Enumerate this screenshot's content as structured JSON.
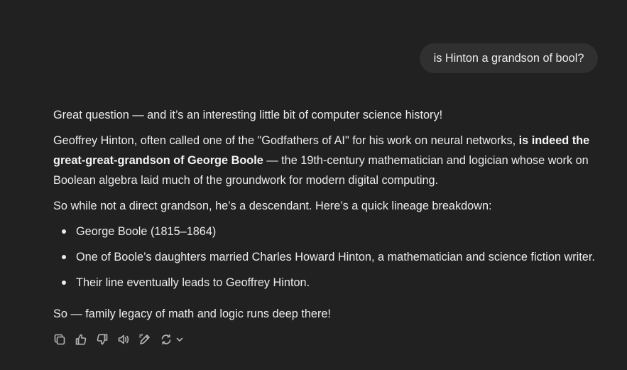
{
  "user_message": "is Hinton a grandson of bool?",
  "assistant": {
    "intro": "Great question — and it’s an interesting little bit of computer science history!",
    "para2_before": "Geoffrey Hinton, often called one of the \"Godfathers of AI\" for his work on neural networks, ",
    "para2_bold": "is indeed the great-great-grandson of George Boole",
    "para2_after": " — the 19th-century mathematician and logician whose work on Boolean algebra laid much of the groundwork for modern digital computing.",
    "para3": "So while not a direct grandson, he’s a descendant. Here’s a quick lineage breakdown:",
    "lineage": [
      "George Boole (1815–1864)",
      "One of Boole’s daughters married Charles Howard Hinton, a mathematician and science fiction writer.",
      "Their line eventually leads to Geoffrey Hinton."
    ],
    "closing": "So — family legacy of math and logic runs deep there!"
  },
  "actions": {
    "icons": [
      "copy-icon",
      "thumbs-up-icon",
      "thumbs-down-icon",
      "speaker-icon",
      "edit-icon",
      "regenerate-icon",
      "chevron-down-icon"
    ]
  },
  "colors": {
    "background": "#212121",
    "user_bubble": "#303030",
    "text": "#ececec",
    "icon": "#b4b4b4"
  }
}
